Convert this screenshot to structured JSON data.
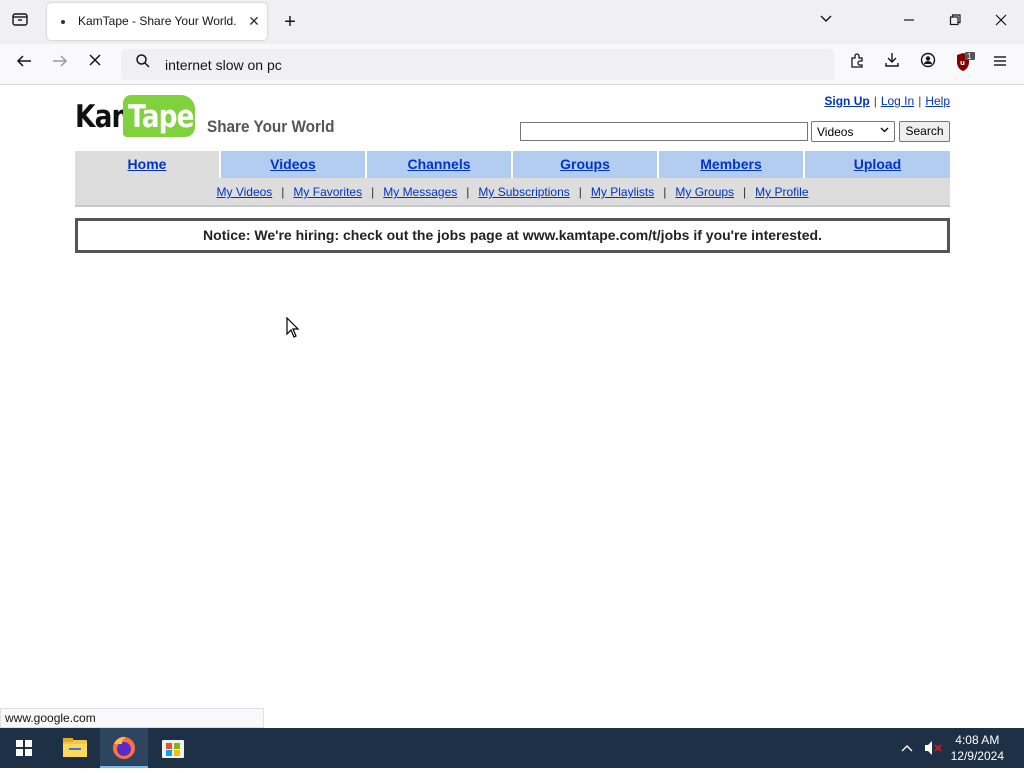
{
  "browser": {
    "tab_title": "KamTape - Share Your World.",
    "tab_close": "✕",
    "new_tab": "+",
    "url": "internet slow on pc",
    "status_url": "www.google.com",
    "extension_badge": "1"
  },
  "site": {
    "logo_kam": "Kam",
    "logo_tape": "Tape",
    "tagline": "Share Your World",
    "top_links": [
      "Sign Up",
      "Log In",
      "Help"
    ],
    "search": {
      "value": "",
      "category": "Videos",
      "button": "Search"
    },
    "nav_tabs": [
      "Home",
      "Videos",
      "Channels",
      "Groups",
      "Members",
      "Upload"
    ],
    "active_tab": "Home",
    "sub_nav": [
      "My Videos",
      "My Favorites",
      "My Messages",
      "My Subscriptions",
      "My Playlists",
      "My Groups",
      "My Profile"
    ],
    "notice": "Notice: We're hiring: check out the jobs page at www.kamtape.com/t/jobs if you're interested."
  },
  "taskbar": {
    "time": "4:08 AM",
    "date": "12/9/2024"
  },
  "colors": {
    "link": "#0033cc",
    "tab_blue": "#b3cdf0",
    "tab_active": "#dddddd",
    "logo_green": "#7fd23c",
    "taskbar": "#1e3046"
  }
}
